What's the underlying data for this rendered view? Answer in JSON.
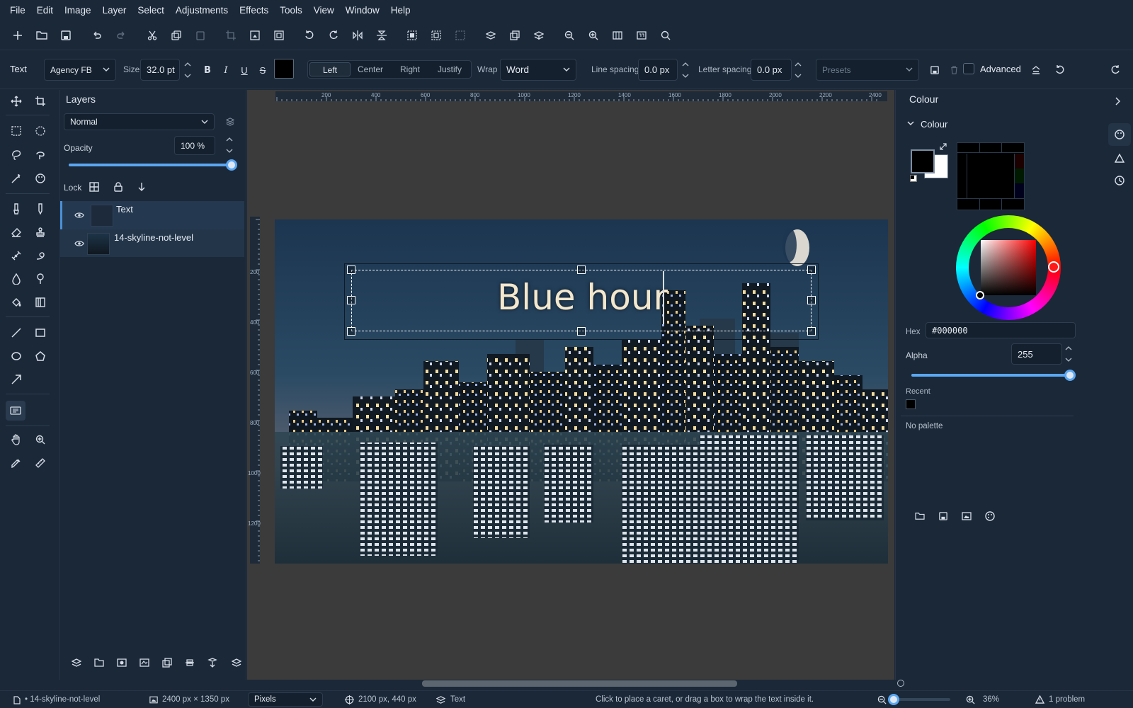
{
  "menu": [
    "File",
    "Edit",
    "Image",
    "Layer",
    "Select",
    "Adjustments",
    "Effects",
    "Tools",
    "View",
    "Window",
    "Help"
  ],
  "options": {
    "tool_label": "Text",
    "font": "Agency FB",
    "size_label": "Size",
    "size_value": "32.0 pt",
    "bold": "B",
    "italic": "I",
    "underline": "U",
    "strike": "S",
    "fill_color": "#000000",
    "align": [
      "Left",
      "Center",
      "Right",
      "Justify"
    ],
    "align_selected": "Left",
    "wrap_label": "Wrap",
    "wrap_value": "Word",
    "line_spacing_label": "Line spacing",
    "line_spacing_value": "0.0 px",
    "letter_spacing_label": "Letter spacing",
    "letter_spacing_value": "0.0 px",
    "presets_placeholder": "Presets",
    "advanced_label": "Advanced"
  },
  "layers_panel": {
    "title": "Layers",
    "blend_mode": "Normal",
    "opacity_label": "Opacity",
    "opacity_value": "100 %",
    "opacity_level": 1.0,
    "lock_label": "Lock",
    "layers": [
      {
        "name": "Text",
        "selected": true,
        "visible": true
      },
      {
        "name": "14-skyline-not-level",
        "selected": false,
        "visible": true
      }
    ]
  },
  "canvas": {
    "text_content": "Blue hour",
    "ruler_top": [
      "200",
      "400",
      "600",
      "800",
      "1000",
      "1200",
      "1400",
      "1600",
      "1800",
      "2000",
      "2200",
      "2400"
    ],
    "ruler_left": [
      "200",
      "400",
      "600",
      "800",
      "1000",
      "1200"
    ]
  },
  "colour_panel": {
    "title": "Colour",
    "section": "Colour",
    "primary": "#000000",
    "secondary": "#ffffff",
    "hex_label": "Hex",
    "hex_value": "#000000",
    "alpha_label": "Alpha",
    "alpha_value": "255",
    "recent_label": "Recent",
    "palette_text": "No palette"
  },
  "status": {
    "document": "• 14-skyline-not-level",
    "image_size": "2400 px × 1350 px",
    "units": "Pixels",
    "cursor": "2100 px, 440 px",
    "layer": "Text",
    "hint": "Click to place a caret, or drag a box to wrap the text inside it.",
    "zoom": "36%",
    "problems": "1 problem"
  }
}
